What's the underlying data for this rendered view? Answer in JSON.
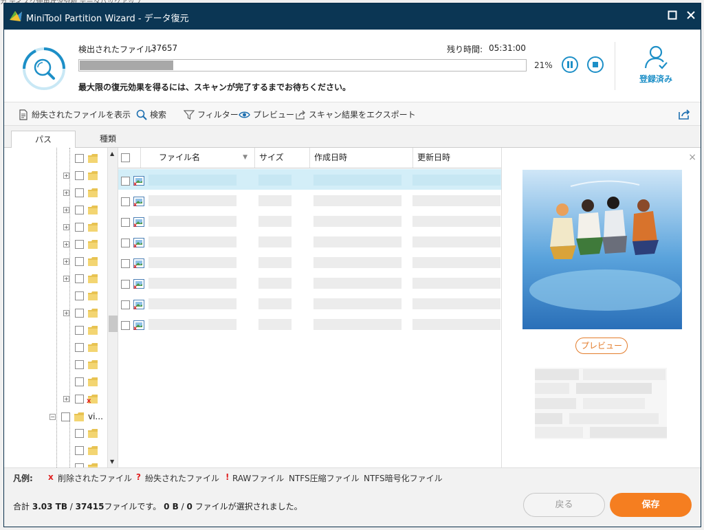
{
  "background_hint": "カ ディスク使用状況分析 データバックアップ",
  "window": {
    "title": "MiniTool Partition Wizard - データ復元",
    "maximize_icon": "maximize-icon",
    "close_icon": "close-icon"
  },
  "scan": {
    "files_found_label": "検出されたファイル:",
    "files_found_value": "37657",
    "remaining_label": "残り時間:",
    "remaining_value": "05:31:00",
    "progress_percent": 21,
    "progress_text": "21%",
    "message": "最大限の復元効果を得るには、スキャンが完了するまでお待ちください。"
  },
  "user": {
    "label": "登録済み"
  },
  "toolbar": {
    "show_lost": "紛失されたファイルを表示",
    "search": "検索",
    "filter": "フィルター",
    "preview": "プレビュー",
    "export": "スキャン結果をエクスポート"
  },
  "tabs": [
    {
      "label": "パス",
      "active": true
    },
    {
      "label": "種類",
      "active": false
    }
  ],
  "tree": {
    "folder_label": "vi..."
  },
  "file_table": {
    "headers": [
      "ファイル名",
      "サイズ",
      "作成日時",
      "更新日時"
    ]
  },
  "preview_panel": {
    "button": "プレビュー"
  },
  "legend": {
    "title": "凡例:",
    "deleted_mark": "x",
    "deleted": "削除されたファイル",
    "lost_mark": "?",
    "lost": "紛失されたファイル",
    "raw_mark": "!",
    "raw": "RAWファイル",
    "ntfs_compressed": "NTFS圧縮ファイル",
    "ntfs_encrypted": "NTFS暗号化ファイル"
  },
  "footer": {
    "total_prefix": "合計",
    "total_size": "3.03 TB",
    "slash1": "/",
    "total_files": "37415",
    "files_suffix": "ファイルです。",
    "selected_size": "0 B",
    "slash2": "/",
    "selected_files": "0",
    "selected_suffix": "ファイルが選択されました。",
    "back_button": "戻る",
    "save_button": "保存"
  },
  "colors": {
    "titlebar": "#0b3654",
    "accent_blue": "#1d8fc7",
    "save_orange": "#f57e20",
    "selected_row": "#d3eef8",
    "deleted_red": "#e02020"
  }
}
